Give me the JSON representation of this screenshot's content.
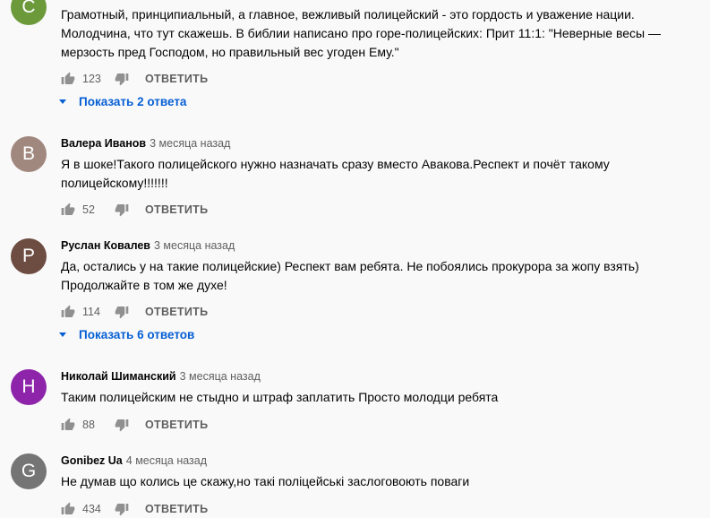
{
  "comments": [
    {
      "avatar_letter": "C",
      "avatar_color": "#6c9a3b",
      "author": "",
      "time": "",
      "text": "Грамотный, принципиальный, а главное,  вежливый полицейский - это гордость и уважение нации. Молодчина, что тут скажешь. В библии написано про горе-полицейских: Прит 11:1: \"Неверные весы — мерзость пред Господом, но правильный вес угоден Ему.\"",
      "likes": "123",
      "reply_label": "ОТВЕТИТЬ",
      "replies_label": "Показать 2 ответа"
    },
    {
      "avatar_letter": "B",
      "avatar_color": "#a1887f",
      "author": "Валера Иванов",
      "time": "3 месяца назад",
      "text": "Я в шоке!Такого полицейского нужно назначать сразу вместо Авакова.Респект и почёт такому полицейскому!!!!!!!",
      "likes": "52",
      "reply_label": "ОТВЕТИТЬ"
    },
    {
      "avatar_letter": "P",
      "avatar_color": "#6d4c41",
      "author": "Руслан Ковалев",
      "time": "3 месяца назад",
      "text": "Да, остались у на такие полицейские) Респект вам ребята. Не побоялись прокурора за жопу взять) Продолжайте в том же духе!",
      "likes": "114",
      "reply_label": "ОТВЕТИТЬ",
      "replies_label": "Показать 6 ответов"
    },
    {
      "avatar_letter": "H",
      "avatar_color": "#8e24aa",
      "author": "Николай Шиманский",
      "time": "3 месяца назад",
      "text": "Таким полицейским не стыдно и штраф заплатить Просто молодци ребята",
      "likes": "88",
      "reply_label": "ОТВЕТИТЬ"
    },
    {
      "avatar_letter": "G",
      "avatar_color": "#757575",
      "author": "Gonibez Ua",
      "time": "4 месяца назад",
      "text": "Не думав що колись це скажу,но такі поліцейські заслоговоють поваги",
      "likes": "434",
      "reply_label": "ОТВЕТИТЬ"
    }
  ]
}
